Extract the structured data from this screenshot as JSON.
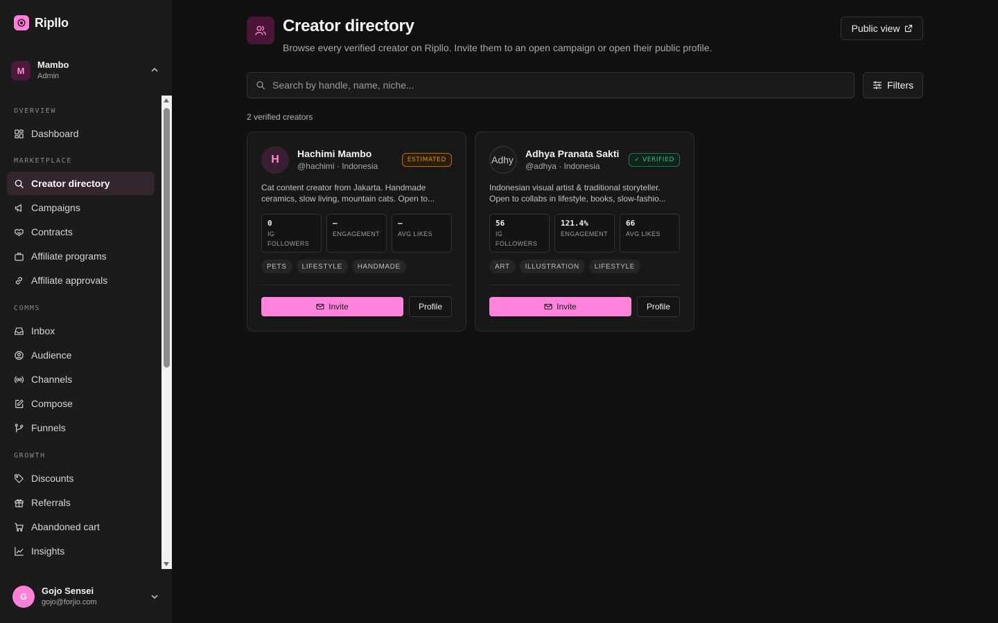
{
  "brand": {
    "name": "Ripllo"
  },
  "workspace": {
    "initial": "M",
    "name": "Mambo",
    "role": "Admin"
  },
  "nav": {
    "sections": [
      {
        "label": "OVERVIEW",
        "items": [
          {
            "label": "Dashboard",
            "icon": "dashboard-icon"
          }
        ]
      },
      {
        "label": "MARKETPLACE",
        "items": [
          {
            "label": "Creator directory",
            "icon": "search-icon",
            "active": true
          },
          {
            "label": "Campaigns",
            "icon": "megaphone-icon"
          },
          {
            "label": "Contracts",
            "icon": "handshake-icon"
          },
          {
            "label": "Affiliate programs",
            "icon": "briefcase-icon"
          },
          {
            "label": "Affiliate approvals",
            "icon": "link-icon"
          }
        ]
      },
      {
        "label": "COMMS",
        "items": [
          {
            "label": "Inbox",
            "icon": "inbox-icon"
          },
          {
            "label": "Audience",
            "icon": "user-circle-icon"
          },
          {
            "label": "Channels",
            "icon": "broadcast-icon"
          },
          {
            "label": "Compose",
            "icon": "pencil-icon"
          },
          {
            "label": "Funnels",
            "icon": "funnel-icon"
          }
        ]
      },
      {
        "label": "GROWTH",
        "items": [
          {
            "label": "Discounts",
            "icon": "tag-icon"
          },
          {
            "label": "Referrals",
            "icon": "gift-icon"
          },
          {
            "label": "Abandoned cart",
            "icon": "cart-icon"
          },
          {
            "label": "Insights",
            "icon": "chart-icon"
          }
        ]
      }
    ]
  },
  "user": {
    "initial": "G",
    "name": "Gojo Sensei",
    "email": "gojo@forjio.com"
  },
  "header": {
    "title": "Creator directory",
    "subtitle": "Browse every verified creator on Ripllo. Invite them to an open campaign or open their public profile.",
    "public_view_label": "Public view"
  },
  "search": {
    "placeholder": "Search by handle, name, niche...",
    "value": ""
  },
  "filters_label": "Filters",
  "count_text": "2 verified creators",
  "creators": [
    {
      "avatar_text": "H",
      "name": "Hachimi Mambo",
      "handle": "@hachimi · Indonesia",
      "badge": "ESTIMATED",
      "bio": "Cat content creator from Jakarta. Handmade ceramics, slow living, mountain cats. Open to...",
      "stats": [
        {
          "value": "0",
          "label": "IG FOLLOWERS"
        },
        {
          "value": "–",
          "label": "ENGAGEMENT"
        },
        {
          "value": "–",
          "label": "AVG LIKES"
        }
      ],
      "tags": [
        "PETS",
        "LIFESTYLE",
        "HANDMADE"
      ],
      "invite_label": "Invite",
      "profile_label": "Profile"
    },
    {
      "avatar_text": "Adhy",
      "name": "Adhya Pranata Sakti",
      "handle": "@adhya · Indonesia",
      "badge": "✓ VERIFIED",
      "bio": "Indonesian visual artist & traditional storyteller. Open to collabs in lifestyle, books, slow-fashio...",
      "stats": [
        {
          "value": "56",
          "label": "IG FOLLOWERS"
        },
        {
          "value": "121.4%",
          "label": "ENGAGEMENT"
        },
        {
          "value": "66",
          "label": "AVG LIKES"
        }
      ],
      "tags": [
        "ART",
        "ILLUSTRATION",
        "LIFESTYLE"
      ],
      "invite_label": "Invite",
      "profile_label": "Profile"
    }
  ],
  "colors": {
    "accent": "#ff82dc",
    "sidebar_bg": "#1b1b1b",
    "main_bg": "#111111",
    "estimated": "#e09030",
    "verified": "#3cc07a"
  }
}
